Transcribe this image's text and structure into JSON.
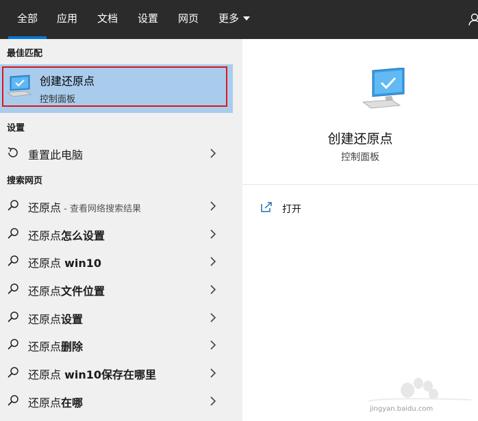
{
  "tabs": [
    {
      "label": "全部",
      "active": true
    },
    {
      "label": "应用"
    },
    {
      "label": "文档"
    },
    {
      "label": "设置"
    },
    {
      "label": "网页"
    },
    {
      "label": "更多"
    }
  ],
  "sections": {
    "best_match": "最佳匹配",
    "settings": "设置",
    "web_search": "搜索网页"
  },
  "best_match": {
    "title": "创建还原点",
    "subtitle": "控制面板",
    "icon": "computer-check-icon"
  },
  "settings_items": [
    {
      "label": "重置此电脑",
      "icon": "reset-pc-icon"
    }
  ],
  "web_items": [
    {
      "normal": "还原点",
      "bold": "",
      "hint": " - 查看网络搜索结果"
    },
    {
      "normal": "还原点",
      "bold": "怎么设置",
      "hint": ""
    },
    {
      "normal": "还原点 ",
      "bold": "win10",
      "hint": ""
    },
    {
      "normal": "还原点",
      "bold": "文件位置",
      "hint": ""
    },
    {
      "normal": "还原点",
      "bold": "设置",
      "hint": ""
    },
    {
      "normal": "还原点",
      "bold": "删除",
      "hint": ""
    },
    {
      "normal": "还原点 ",
      "bold": "win10保存在哪里",
      "hint": ""
    },
    {
      "normal": "还原点",
      "bold": "在哪",
      "hint": ""
    }
  ],
  "detail": {
    "title": "创建还原点",
    "subtitle": "控制面板",
    "open_label": "打开"
  },
  "watermark": {
    "url": "jingyan.baidu.com"
  },
  "colors": {
    "topbar": "#2b2b2b",
    "accent": "#0078d7",
    "selected": "#a9ccec",
    "highlight_border": "#e0141a"
  }
}
